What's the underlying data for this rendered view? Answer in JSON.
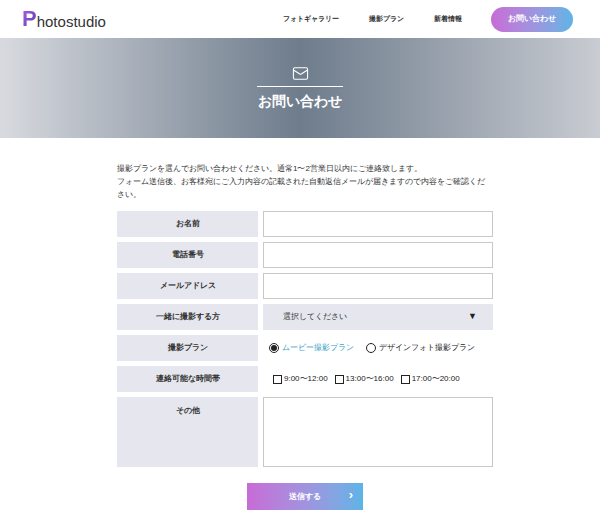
{
  "header": {
    "logo": {
      "initial": "P",
      "rest": "hotostudio"
    },
    "nav": [
      "フォトギャラリー",
      "撮影プラン",
      "新着情報"
    ],
    "contact_button": "お問い合わせ"
  },
  "hero": {
    "title": "お問い合わせ"
  },
  "intro": [
    "撮影プランを選んでお問い合わせください。通常1〜2営業日以内にご連絡致します。",
    "フォーム送信後、お客様宛にご入力内容の記載された自動返信メールが届きますので内容をご確認ください。"
  ],
  "form": {
    "fields": [
      {
        "kind": "text",
        "label": "お名前",
        "value": ""
      },
      {
        "kind": "text",
        "label": "電話番号",
        "value": ""
      },
      {
        "kind": "text",
        "label": "メールアドレス",
        "value": ""
      },
      {
        "kind": "select",
        "label": "一緒に撮影する方",
        "placeholder": "選択してください",
        "arrow": "▼"
      },
      {
        "kind": "radio",
        "label": "撮影プラン",
        "options": [
          {
            "label": "ムービー撮影プラン",
            "selected": true
          },
          {
            "label": "デザインフォト撮影プラン",
            "selected": false
          }
        ]
      },
      {
        "kind": "checkbox",
        "label": "連絡可能な時間帯",
        "options": [
          {
            "label": "9:00〜12:00",
            "checked": false
          },
          {
            "label": "13:00〜16:00",
            "checked": false
          },
          {
            "label": "17:00〜20:00",
            "checked": false
          }
        ]
      },
      {
        "kind": "textarea",
        "label": "その他",
        "value": ""
      }
    ]
  },
  "submit": {
    "label": "送信する",
    "arrow": "›"
  }
}
